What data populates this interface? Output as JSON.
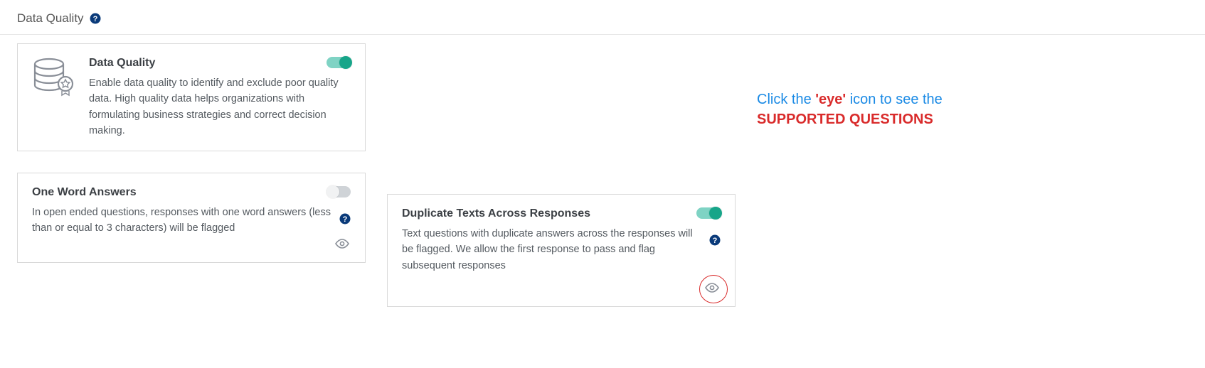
{
  "pageTitle": "Data Quality",
  "cards": {
    "dataQuality": {
      "title": "Data Quality",
      "desc": "Enable data quality to identify and exclude poor quality data. High quality data helps organizations with formulating business strategies and correct decision making.",
      "enabled": true
    },
    "oneWord": {
      "title": "One Word Answers",
      "desc": "In open ended questions, responses with one word answers (less than or equal to 3 characters) will be flagged",
      "enabled": false
    },
    "duplicateTexts": {
      "title": "Duplicate Texts Across Responses",
      "desc": "Text questions with duplicate answers across the responses will be flagged. We allow the first response to pass and flag subsequent responses",
      "enabled": true
    }
  },
  "annotation": {
    "prefix": "Click the ",
    "quoteOpen": "'",
    "eyeWord": "eye",
    "quoteClose": "'",
    "suffix": " icon to see the",
    "line2": "SUPPORTED QUESTIONS"
  }
}
